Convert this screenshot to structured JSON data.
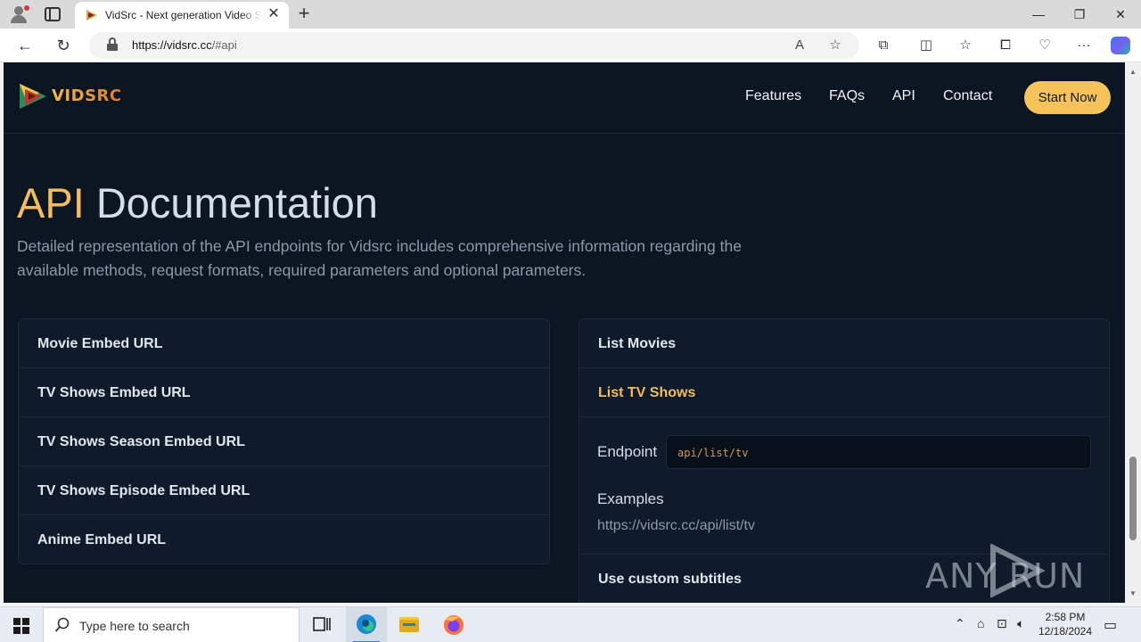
{
  "browser": {
    "tab_title": "VidSrc - Next generation Video Streaming API",
    "url_host": "https://vidsrc.cc",
    "url_path": "/#api"
  },
  "site": {
    "logo_text": "VIDSRC",
    "nav": [
      "Features",
      "FAQs",
      "API",
      "Contact"
    ],
    "cta": "Start Now"
  },
  "hero": {
    "title_highlight": "API",
    "title_rest": " Documentation",
    "subtitle": "Detailed representation of the API endpoints for Vidsrc includes comprehensive information regarding the available methods, request formats, required parameters and optional parameters."
  },
  "left_accordion": [
    "Movie Embed URL",
    "TV Shows Embed URL",
    "TV Shows Season Embed URL",
    "TV Shows Episode Embed URL",
    "Anime Embed URL"
  ],
  "right_accordion": {
    "items_before": [
      "List Movies"
    ],
    "active": "List TV Shows",
    "endpoint_label": "Endpoint",
    "endpoint_value": "api/list/tv",
    "examples_label": "Examples",
    "example_url": "https://vidsrc.cc/api/list/tv",
    "items_after": [
      "Use custom subtitles"
    ]
  },
  "watermark": "ANY RUN",
  "taskbar": {
    "search_placeholder": "Type here to search",
    "time": "2:58 PM",
    "date": "12/18/2024"
  },
  "colors": {
    "page_bg": "#0b1622",
    "accent": "#f3bd5b",
    "card_bg": "#0f1b2a"
  },
  "icons": [
    "profile-icon",
    "tabs-icon",
    "close-icon",
    "plus-icon",
    "minimize-icon",
    "maximize-icon",
    "back-icon",
    "refresh-icon",
    "lock-icon",
    "read-aloud-icon",
    "favorite-icon",
    "extensions-icon",
    "split-screen-icon",
    "favorites-icon",
    "collections-icon",
    "browser-essentials-icon",
    "more-icon",
    "copilot-icon",
    "windows-icon",
    "search-icon",
    "task-view-icon",
    "edge-icon",
    "file-explorer-icon",
    "firefox-icon"
  ]
}
